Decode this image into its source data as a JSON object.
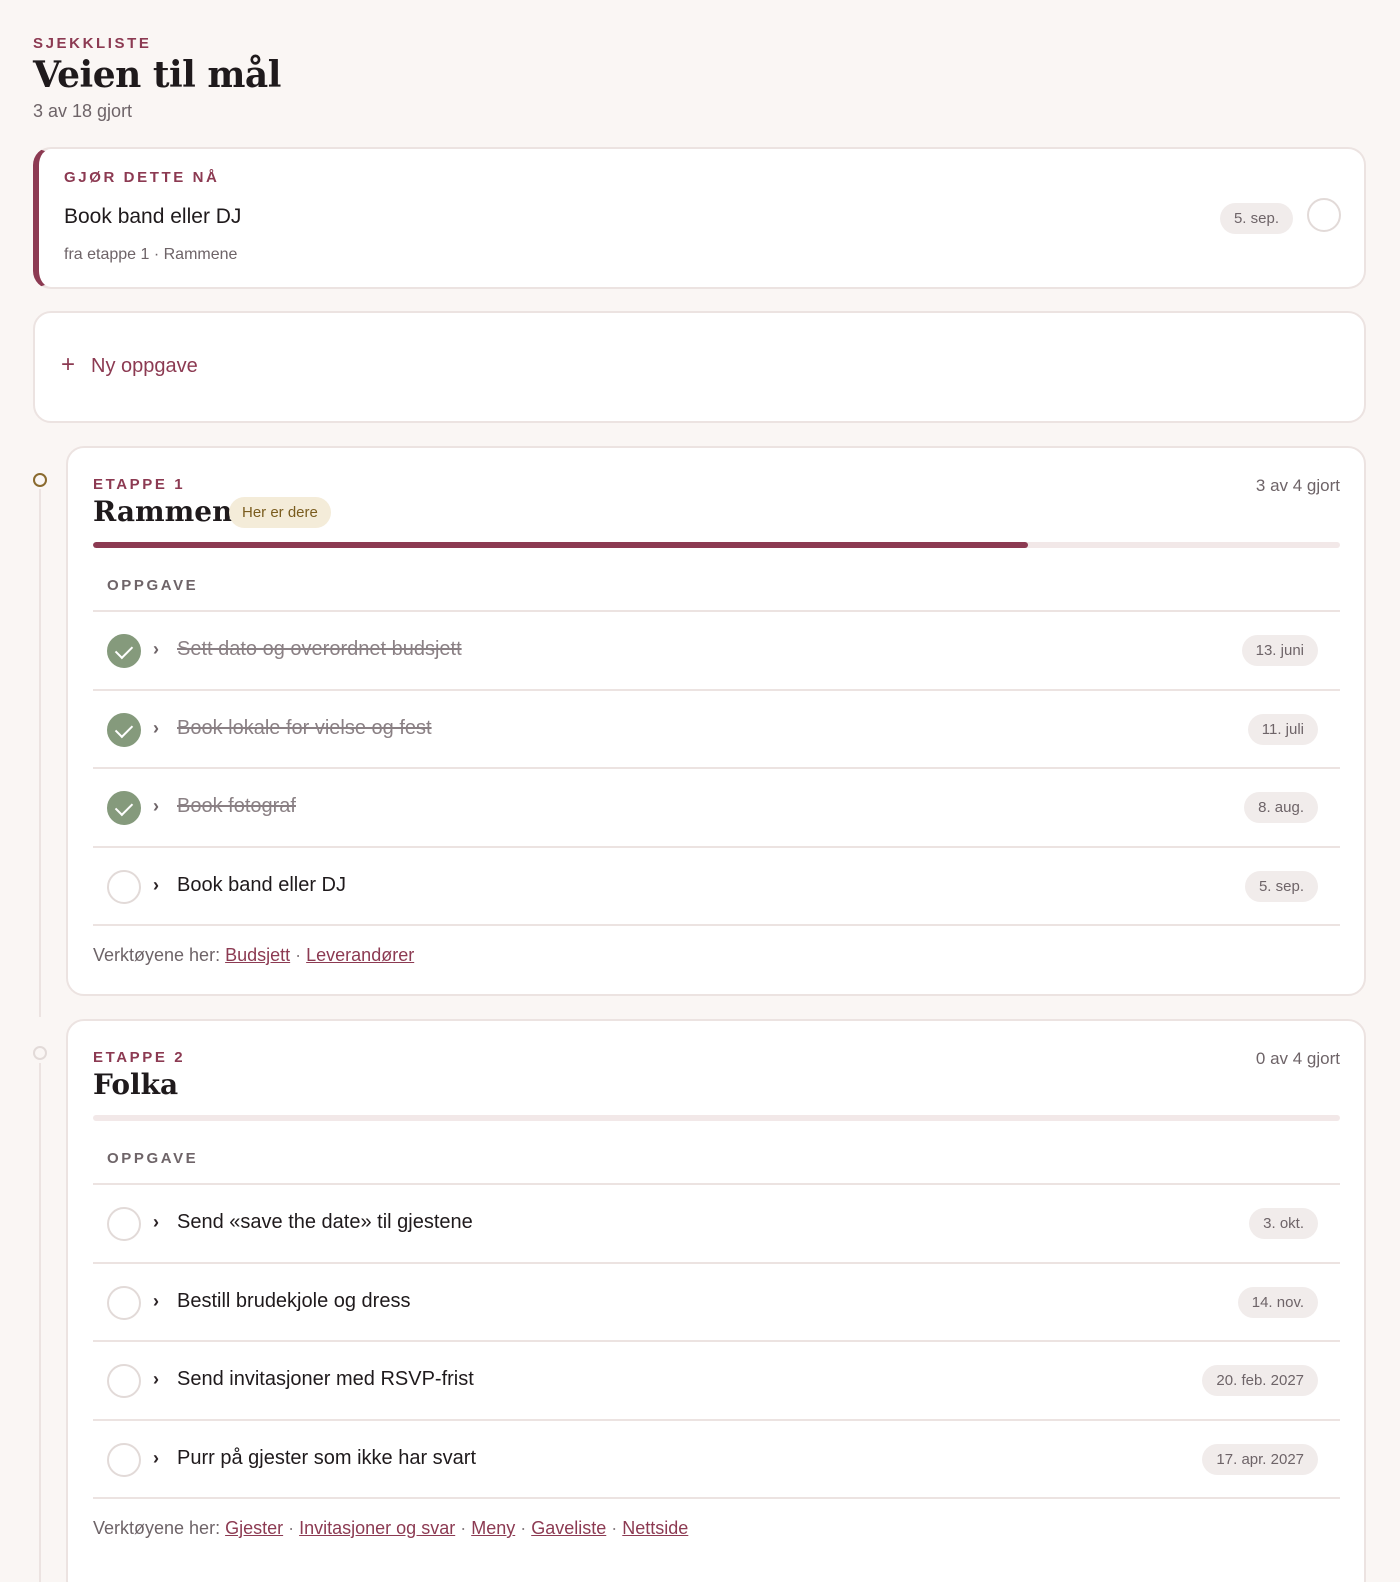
{
  "header": {
    "eyebrow": "SJEKKLISTE",
    "title": "Veien til mål",
    "progress_text": "3 av 18 gjort"
  },
  "do_now": {
    "eyebrow": "GJØR DETTE NÅ",
    "task": "Book band eller DJ",
    "source": "fra etappe 1 · Rammene",
    "due": "5. sep."
  },
  "new_task": {
    "plus": "+",
    "label": "Ny oppgave"
  },
  "stages": [
    {
      "eyebrow": "ETAPPE 1",
      "title": "Rammene",
      "badge": "Her er dere",
      "count": "3 av 4 gjort",
      "progress_fraction": 0.75,
      "column_header": "OPPGAVE",
      "tasks": [
        {
          "label": "Sett dato og overordnet budsjett",
          "due": "13. juni",
          "done": true
        },
        {
          "label": "Book lokale for vielse og fest",
          "due": "11. juli",
          "done": true
        },
        {
          "label": "Book fotograf",
          "due": "8. aug.",
          "done": true
        },
        {
          "label": "Book band eller DJ",
          "due": "5. sep.",
          "done": false
        }
      ],
      "tools_label": "Verktøyene her:",
      "tools": [
        "Budsjett",
        "Leverandører"
      ]
    },
    {
      "eyebrow": "ETAPPE 2",
      "title": "Folka",
      "badge": "",
      "count": "0 av 4 gjort",
      "progress_fraction": 0,
      "column_header": "OPPGAVE",
      "tasks": [
        {
          "label": "Send «save the date» til gjestene",
          "due": "3. okt.",
          "done": false
        },
        {
          "label": "Bestill brudekjole og dress",
          "due": "14. nov.",
          "done": false
        },
        {
          "label": "Send invitasjoner med RSVP-frist",
          "due": "20. feb. 2027",
          "done": false
        },
        {
          "label": "Purr på gjester som ikke har svart",
          "due": "17. apr. 2027",
          "done": false
        }
      ],
      "tools_label": "Verktøyene her:",
      "tools": [
        "Gjester",
        "Invitasjoner og svar",
        "Meny",
        "Gaveliste",
        "Nettside"
      ]
    }
  ],
  "colors": {
    "accent": "#8c3a52",
    "done_green": "#859a7c",
    "badge_bg": "#f4ecd9",
    "current_dot": "#8a6a2e"
  }
}
